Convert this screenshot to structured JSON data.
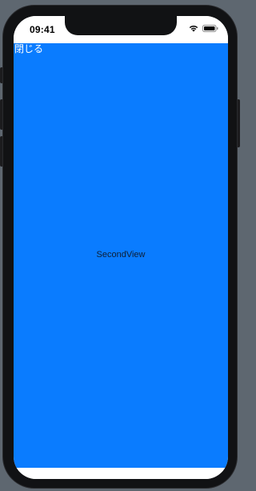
{
  "status_bar": {
    "time": "09:41",
    "wifi_icon": "wifi-icon",
    "battery_icon": "battery-icon"
  },
  "nav": {
    "close_label": "閉じる"
  },
  "main": {
    "title": "SecondView",
    "background_color": "#0a7cff"
  }
}
